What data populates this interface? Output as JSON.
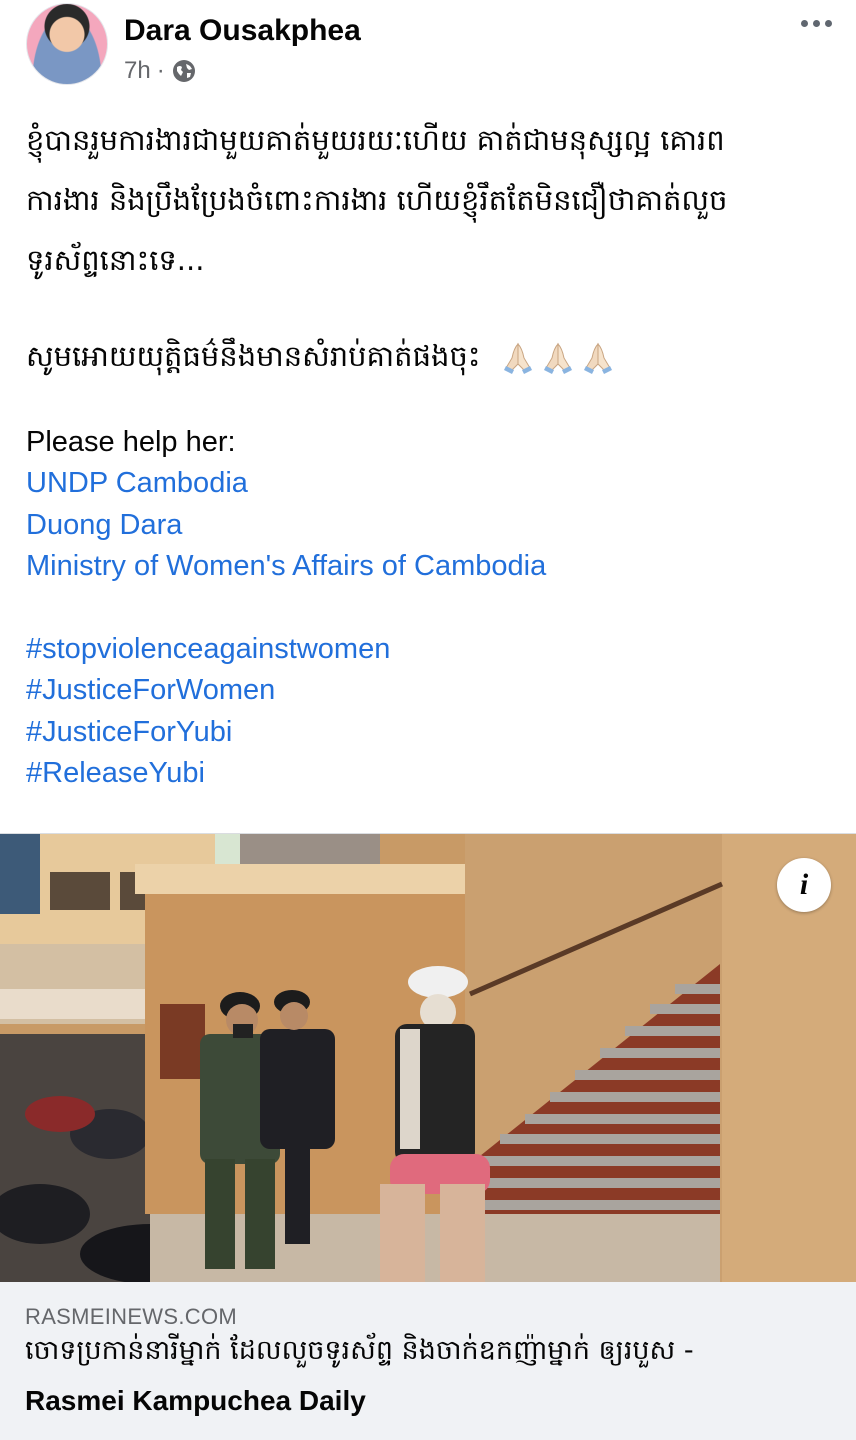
{
  "post": {
    "author_name": "Dara Ousakphea",
    "time": "7h",
    "separator": "·",
    "audience_icon": "globe-icon",
    "more_icon": "more-horizontal-icon"
  },
  "body": {
    "khmer_line_1": "ខ្ញុំបានរួមការងារជាមួយគាត់មួយរយៈហើយ គាត់ជាមនុស្សល្អ គោរព",
    "khmer_line_2": "ការងារ និងប្រឹងប្រែងចំពោះការងារ ហើយខ្ញុំរឹតតែមិនជឿថាគាត់លួច",
    "khmer_line_3": "ទូរស័ព្ទនោះទេ...",
    "khmer_prayer": "សូមអោយយុត្តិធម៌នឹងមានសំរាប់គាត់ផងចុះ",
    "prayer_emoji": "folded-hands-icon",
    "help_text": "Please help her:",
    "mentions": [
      "UNDP Cambodia",
      "Duong Dara",
      "Ministry of Women's Affairs of Cambodia"
    ],
    "hashtags": [
      "#stopviolenceagainstwomen",
      "#JusticeForWomen",
      "#JusticeForYubi",
      "#ReleaseYubi"
    ]
  },
  "link_preview": {
    "info_label": "i",
    "domain": "RASMEINEWS.COM",
    "title": "ចោទប្រកាន់នារីម្នាក់ ដែលលួចទូរស័ព្ទ និងចាក់ឧកញ៉ាម្នាក់ ឲ្យរបួស -",
    "site_name": "Rasmei Kampuchea Daily"
  },
  "colors": {
    "link": "#216fdb",
    "text": "#050505",
    "meta": "#65676b",
    "caption_bg": "#f0f2f5"
  }
}
